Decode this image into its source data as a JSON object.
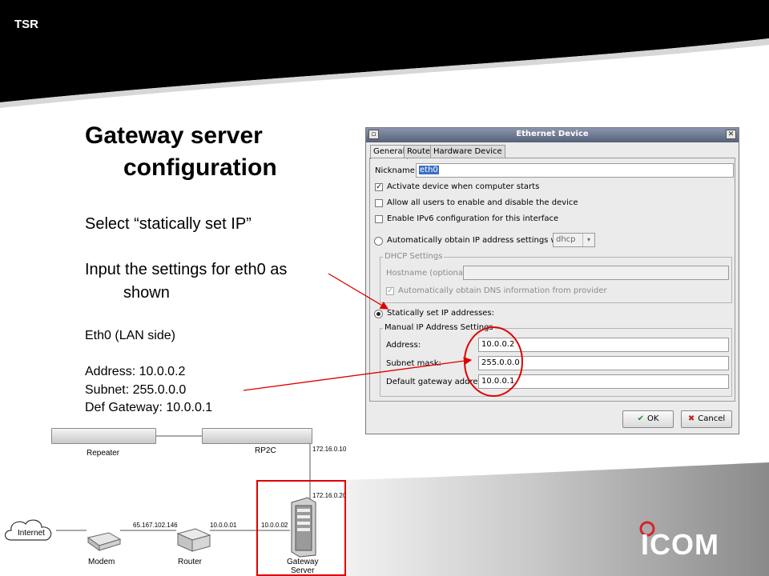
{
  "header": {
    "label": "TSR"
  },
  "slide": {
    "title_line1": "Gateway server",
    "title_line2": "configuration",
    "instruction1": "Select “statically set IP”",
    "instruction2_line1": "Input the settings for eth0 as",
    "instruction2_line2": "shown",
    "eth_heading": "Eth0 (LAN side)",
    "address_line": "Address: 10.0.0.2",
    "subnet_line": "Subnet: 255.0.0.0",
    "gateway_line": "Def Gateway: 10.0.0.1"
  },
  "dialog": {
    "title": "Ethernet Device",
    "tabs": [
      "General",
      "Route",
      "Hardware Device"
    ],
    "nickname_label": "Nickname:",
    "nickname_value": "eth0",
    "chk_activate": "Activate device when computer starts",
    "chk_allow_users": "Allow all users to enable and disable the device",
    "chk_ipv6": "Enable IPv6 configuration for this interface",
    "radio_auto": "Automatically obtain IP address settings with:",
    "auto_method": "dhcp",
    "dhcp_group": "DHCP Settings",
    "hostname_label": "Hostname (optional):",
    "chk_dns": "Automatically obtain DNS information from provider",
    "radio_static": "Statically set IP addresses:",
    "manual_group": "Manual IP Address Settings",
    "address_label": "Address:",
    "address_value": "10.0.0.2",
    "subnet_label": "Subnet mask:",
    "subnet_value": "255.0.0.0",
    "gateway_label": "Default gateway address:",
    "gateway_value": "10.0.0.1",
    "ok_label": "OK",
    "cancel_label": "Cancel"
  },
  "diagram": {
    "repeater": "Repeater",
    "rp2c": "RP2C",
    "internet": "Internet",
    "modem": "Modem",
    "router": "Router",
    "gateway_server_line1": "Gateway",
    "gateway_server_line2": "Server",
    "ip_wan": "65.167.102.146",
    "ip_router_lan": "10.0.0.01",
    "ip_gw_lan": "10.0.0.02",
    "ip_rp2c": "172.16.0.10",
    "ip_gw_rp": "172.16.0.20"
  },
  "brand": {
    "logo_text": "ICOM"
  },
  "colors": {
    "header": "#000000",
    "annotation_red": "#e00000",
    "dialog_title": "#6a7690",
    "footer_gray": "#9a9a9a"
  }
}
